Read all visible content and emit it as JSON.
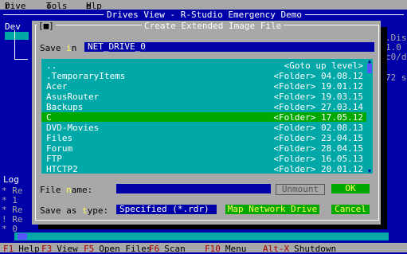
{
  "menu": {
    "drive": {
      "hot": "D",
      "rest": "rive"
    },
    "tools": {
      "hot": "T",
      "rest": "ools"
    },
    "help": {
      "hot": "H",
      "rest": "elp"
    }
  },
  "window_title": "Drives View - R-Studio Emergency Demo",
  "background": {
    "dev_label": "Dev",
    "right_1": ".Dis",
    "right_2": "1.0",
    "right_3": "c0/d",
    "right_4": "72 s",
    "log_label": "Log",
    "log_lines": [
      "* Re",
      "* 1",
      "* Re",
      "! Re",
      "* 0"
    ]
  },
  "dialog": {
    "close_glyph": "[■]",
    "title": "Create Extended Image File",
    "save_in_label_pre": "Save ",
    "save_in_label_hot": "i",
    "save_in_label_post": "n",
    "save_in_value": "NET_DRIVE_0",
    "files": [
      {
        "name": "..",
        "desc": "<Goto up level>"
      },
      {
        "name": ".TemporaryItems",
        "desc": "<Folder> 04.08.12"
      },
      {
        "name": "Acer",
        "desc": "<Folder> 19.01.12"
      },
      {
        "name": "AsusRouter",
        "desc": "<Folder> 19.03.15"
      },
      {
        "name": "Backups",
        "desc": "<Folder> 27.03.14"
      },
      {
        "name": "C",
        "desc": "<Folder> 17.05.12"
      },
      {
        "name": "DVD-Movies",
        "desc": "<Folder> 02.08.13"
      },
      {
        "name": "Files",
        "desc": "<Folder> 23.04.15"
      },
      {
        "name": "Forum",
        "desc": "<Folder> 28.04.15"
      },
      {
        "name": "FTP",
        "desc": "<Folder> 16.05.13"
      },
      {
        "name": "HTCTP2",
        "desc": "<Folder> 20.01.12"
      }
    ],
    "selected_index": 5,
    "file_name_label_pre": "File ",
    "file_name_label_hot": "n",
    "file_name_label_post": "ame:",
    "file_name_value": "",
    "unmount_label": "Unmount",
    "ok_label": "OK",
    "save_as_label_pre": "Save as ",
    "save_as_label_hot": "t",
    "save_as_label_post": "ype:",
    "save_as_value": "Specified (*.rdr)",
    "map_network_drive_label": "Map Network Drive",
    "cancel_label": "Cancel"
  },
  "statusbar": [
    {
      "key": "F1",
      "label": "Help"
    },
    {
      "key": "F3",
      "label": "View"
    },
    {
      "key": "F5",
      "label": "Open Files"
    },
    {
      "key": "F6",
      "label": "Scan"
    },
    {
      "key": "F10",
      "label": "Menu"
    },
    {
      "key": "Alt-X",
      "label": "Shutdown"
    }
  ],
  "colors": {
    "background": "#0000a8",
    "dialog": "#a8a8a8",
    "list": "#00a8a8",
    "selection": "#00a800",
    "hotkey": "#ffff55"
  }
}
